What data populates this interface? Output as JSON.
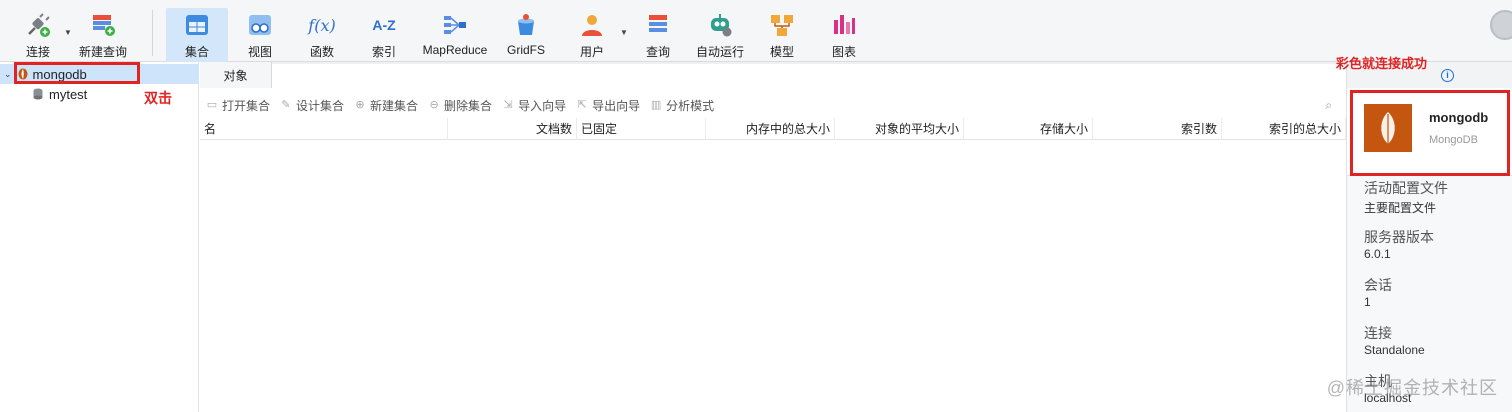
{
  "toolbar": {
    "connect": "连接",
    "new_query": "新建查询",
    "collection": "集合",
    "view": "视图",
    "function": "函数",
    "function_glyph": "f(x)",
    "index": "索引",
    "index_glyph": "A-Z",
    "mapreduce": "MapReduce",
    "gridfs": "GridFS",
    "user": "用户",
    "query": "查询",
    "automation": "自动运行",
    "model": "模型",
    "chart": "图表"
  },
  "tree": {
    "connection": "mongodb",
    "database": "mytest"
  },
  "annotations": {
    "double_click": "双击",
    "colored_connected": "彩色就连接成功"
  },
  "tabs": {
    "objects": "对象"
  },
  "actions": {
    "open_collection": "打开集合",
    "design_collection": "设计集合",
    "new_collection": "新建集合",
    "delete_collection": "删除集合",
    "import_wizard": "导入向导",
    "export_wizard": "导出向导",
    "analyze_mode": "分析模式"
  },
  "table": {
    "columns": [
      "名",
      "文档数",
      "已固定",
      "内存中的总大小",
      "对象的平均大小",
      "存储大小",
      "索引数",
      "索引的总大小"
    ]
  },
  "info": {
    "name": "mongodb",
    "type": "MongoDB",
    "active_profile_label": "活动配置文件",
    "active_profile_value": "主要配置文件",
    "server_version_label": "服务器版本",
    "server_version_value": "6.0.1",
    "sessions_label": "会话",
    "sessions_value": "1",
    "connection_label": "连接",
    "connection_value": "Standalone",
    "host_label": "主机",
    "host_value": "localhost"
  },
  "watermark": "@稀土掘金技术社区",
  "colors": {
    "accent_blue": "#1e6fd9",
    "selection": "#cde4fb",
    "annotation_red": "#e02424",
    "mongo_logo_bg": "#c4560f"
  }
}
